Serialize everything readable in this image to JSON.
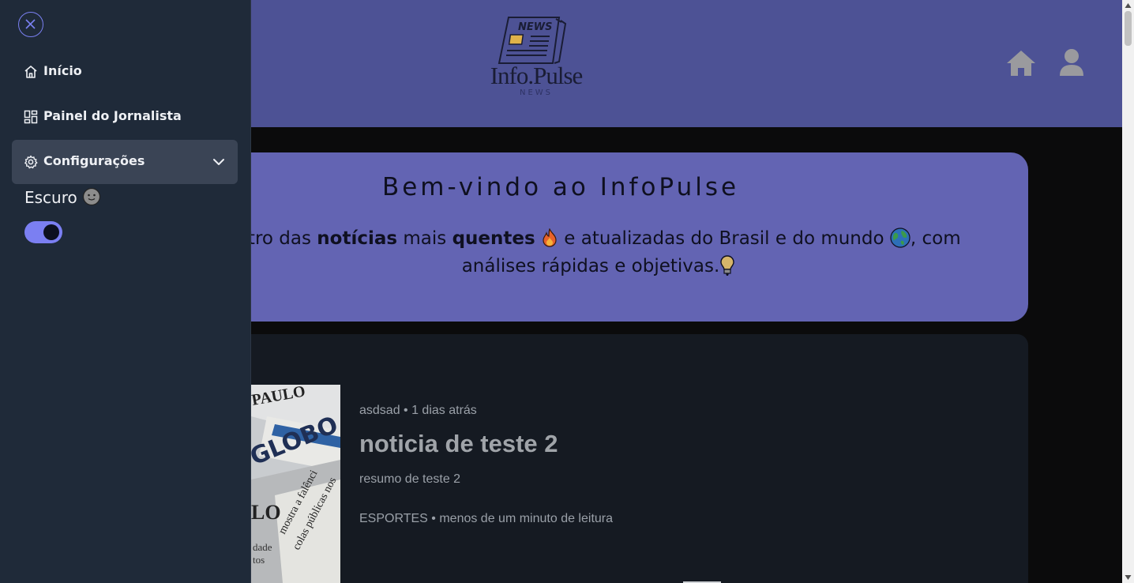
{
  "header": {
    "logo_badge": "NEWS",
    "logo_text": "Info.Pulse",
    "logo_sub": "NEWS",
    "home_icon": "home-icon",
    "user_icon": "user-icon"
  },
  "welcome": {
    "title": "Bem-vindo ao InfoPulse",
    "text_pre": "ntro das ",
    "text_bold1": "notícias",
    "text_mid1": " mais ",
    "text_bold2": "quentes",
    "text_mid2": " e atualizadas do Brasil e do mundo ",
    "text_mid3": ", com",
    "text_line2": "análises rápidas e objetivas."
  },
  "news": [
    {
      "meta": "asdsad • 1 dias atrás",
      "title": "noticia de teste 2",
      "summary": "resumo de teste 2",
      "footer": "ESPORTES • menos de um minuto de leitura"
    }
  ],
  "sidebar": {
    "close_icon": "close-icon",
    "items": [
      {
        "label": "Início",
        "icon": "home-icon"
      },
      {
        "label": "Painel do Jornalista",
        "icon": "dashboard-icon"
      },
      {
        "label": "Configurações",
        "icon": "gear-icon"
      }
    ],
    "theme_label": "Escuro",
    "theme_enabled": true
  },
  "colors": {
    "header_bg": "#4d5295",
    "welcome_bg": "#6364b3",
    "sidebar_bg": "#1f2a39",
    "accent": "#7b7ff2"
  }
}
